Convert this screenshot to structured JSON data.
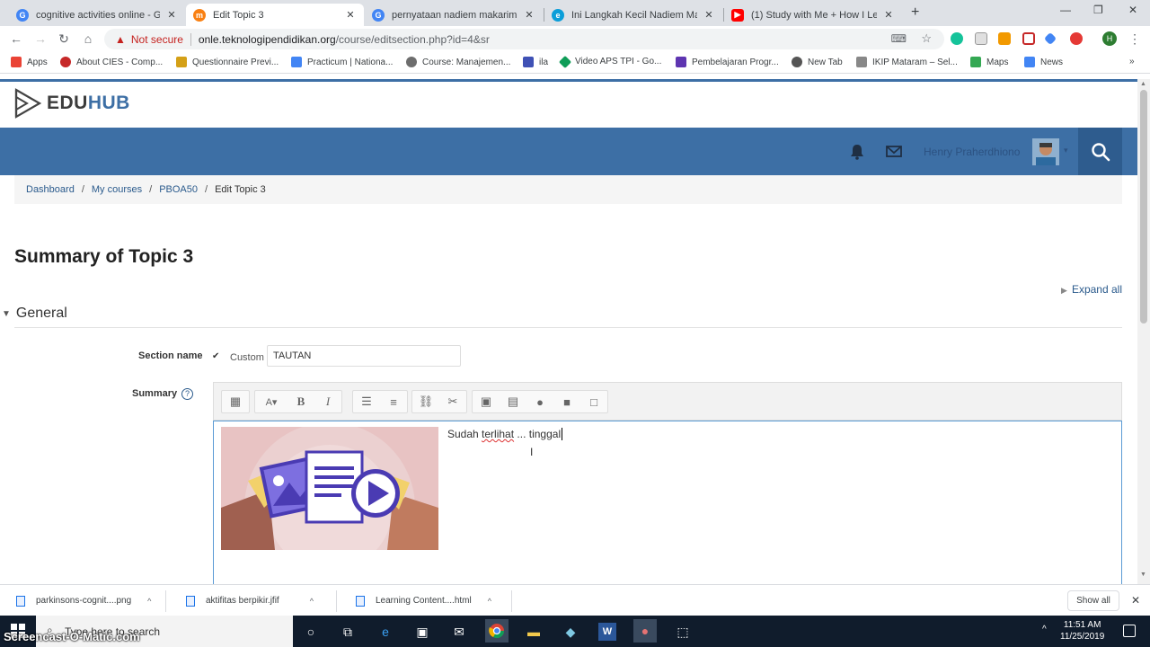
{
  "browser": {
    "tabs": [
      {
        "title": "cognitive activities online - Goog",
        "fav": "G",
        "color": "#4285f4"
      },
      {
        "title": "Edit Topic 3",
        "fav": "m",
        "color": "#f98012"
      },
      {
        "title": "pernyataan nadiem makarim ten",
        "fav": "G",
        "color": "#4285f4"
      },
      {
        "title": "Ini Langkah Kecil Nadiem Makari",
        "fav": "e",
        "color": "#0b9ed9"
      },
      {
        "title": "(1) Study with Me + How I Learn",
        "fav": "▶",
        "color": "#ff0000"
      }
    ],
    "not_secure": "Not secure",
    "url_host": "onle.teknologipendidikan.org",
    "url_path": "/course/editsection.php?id=4&sr",
    "bookmarks": [
      {
        "label": "Apps",
        "color": "#ea4335"
      },
      {
        "label": "About CIES - Comp...",
        "color": "#c62828"
      },
      {
        "label": "Questionnaire Previ...",
        "color": "#d4a017"
      },
      {
        "label": "Practicum | Nationa...",
        "color": "#4285f4"
      },
      {
        "label": "Course: Manajemen...",
        "color": "#6d6d6d"
      },
      {
        "label": "ila",
        "color": "#3f51b5"
      },
      {
        "label": "Video APS TPI - Go...",
        "color": "#0f9d58"
      },
      {
        "label": "Pembelajaran Progr...",
        "color": "#5e35b1"
      },
      {
        "label": "New Tab",
        "color": "#555555"
      },
      {
        "label": "IKIP Mataram – Sel...",
        "color": "#888888"
      },
      {
        "label": "Maps",
        "color": "#34a853"
      },
      {
        "label": "News",
        "color": "#4285f4"
      }
    ]
  },
  "site": {
    "logo_edu": "EDU",
    "logo_hub": "HUB",
    "user_name": "Henry Praherdhiono",
    "accent": "#3d6fa5"
  },
  "breadcrumb": [
    "Dashboard",
    "My courses",
    "PBOA50",
    "Edit Topic 3"
  ],
  "page_title": "Summary of Topic 3",
  "expand_all": "Expand all",
  "general": "General",
  "form": {
    "section_name_label": "Section name",
    "custom_label": "Custom",
    "section_name_value": "TAUTAN",
    "summary_label": "Summary",
    "help_glyph": "?",
    "editor_text_1": "Sudah ",
    "editor_text_2": "terlihat",
    "editor_text_3": " ... tinggal"
  },
  "downloads": [
    {
      "name": "parkinsons-cognit....png"
    },
    {
      "name": "aktifitas berpikir.jfif"
    },
    {
      "name": "Learning Content....html"
    }
  ],
  "show_all": "Show all",
  "taskbar": {
    "search_placeholder": "Type here to search",
    "time": "11:51 AM",
    "date": "11/25/2019"
  },
  "watermark": "Screencast-O-Matic.com"
}
